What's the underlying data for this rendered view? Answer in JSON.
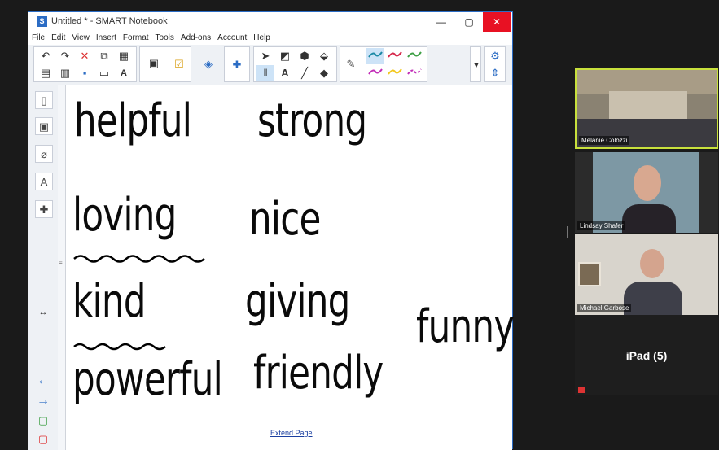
{
  "window": {
    "title": "Untitled * - SMART Notebook",
    "minimize": "—",
    "maximize": "▢",
    "close": "✕"
  },
  "menu": [
    "File",
    "Edit",
    "View",
    "Insert",
    "Format",
    "Tools",
    "Add-ons",
    "Account",
    "Help"
  ],
  "canvas": {
    "words": [
      "helpful",
      "strong",
      "loving",
      "nice",
      "kind",
      "giving",
      "funny",
      "powerful",
      "friendly"
    ],
    "extend_link": "Extend Page"
  },
  "participants": [
    {
      "name": "Melanie Colozzi",
      "active_speaker": true
    },
    {
      "name": "Lindsay Shafer"
    },
    {
      "name": "Michael Garbose"
    },
    {
      "name": "iPad (5)"
    }
  ],
  "colors": {
    "accent": "#2b6cc4",
    "speaker_border": "#c8e03c",
    "pen_teal": "#1c8aa6",
    "pen_red": "#d6284b",
    "pen_green": "#3fa046",
    "pen_magenta": "#c22fb8",
    "pen_yellow": "#f2c81e"
  }
}
